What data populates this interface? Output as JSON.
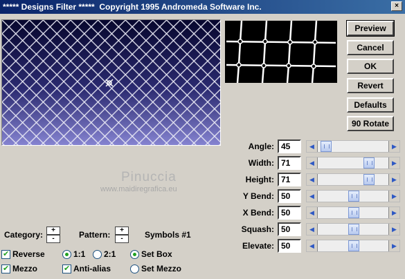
{
  "window": {
    "title": "***** Designs Filter *****  Copyright 1995 Andromeda Software Inc."
  },
  "buttons": {
    "preview": "Preview",
    "cancel": "Cancel",
    "ok": "OK",
    "revert": "Revert",
    "defaults": "Defaults",
    "rotate": "90 Rotate"
  },
  "params": [
    {
      "label": "Angle:",
      "value": "45",
      "level": 0.12
    },
    {
      "label": "Width:",
      "value": "71",
      "level": 0.71
    },
    {
      "label": "Height:",
      "value": "71",
      "level": 0.71
    },
    {
      "label": "Y Bend:",
      "value": "50",
      "level": 0.5
    },
    {
      "label": "X Bend:",
      "value": "50",
      "level": 0.5
    },
    {
      "label": "Squash:",
      "value": "50",
      "level": 0.5
    },
    {
      "label": "Elevate:",
      "value": "50",
      "level": 0.5
    }
  ],
  "category": {
    "label": "Category:",
    "plus": "+",
    "minus": "-"
  },
  "pattern": {
    "label": "Pattern:",
    "plus": "+",
    "minus": "-",
    "value": "Symbols #1"
  },
  "options": {
    "reverse": {
      "label": "Reverse",
      "checked": true
    },
    "mezzo": {
      "label": "Mezzo",
      "checked": true
    },
    "ratio_1_1": {
      "label": "1:1",
      "selected": true
    },
    "ratio_2_1": {
      "label": "2:1",
      "selected": false
    },
    "anti_alias": {
      "label": "Anti-alias",
      "checked": true
    },
    "set_box": {
      "label": "Set Box",
      "selected": true
    },
    "set_mezzo": {
      "label": "Set Mezzo",
      "selected": false
    }
  },
  "watermark": {
    "name": "Pinuccia",
    "url": "www.maidiregrafica.eu"
  },
  "colors": {
    "titlebar": "#0a246a",
    "preview_top": "#0a0a3a",
    "preview_bottom": "#7a78c8",
    "check": "#21a121"
  }
}
